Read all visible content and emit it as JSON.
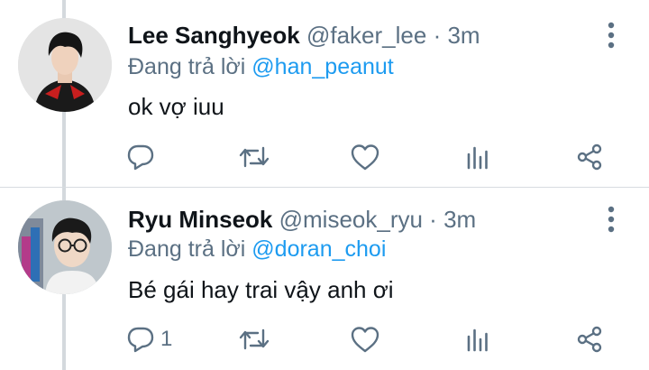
{
  "tweets": [
    {
      "display_name": "Lee Sanghyeok",
      "handle": "@faker_lee",
      "separator": "·",
      "time": "3m",
      "reply_prefix": "Đang trả lời",
      "reply_to": "@han_peanut",
      "text": "ok vợ iuu",
      "reply_count": ""
    },
    {
      "display_name": "Ryu Minseok",
      "handle": "@miseok_ryu",
      "separator": "·",
      "time": "3m",
      "reply_prefix": "Đang trả lời",
      "reply_to": "@doran_choi",
      "text": "Bé gái hay trai vậy anh ơi",
      "reply_count": "1"
    }
  ],
  "icons": {
    "reply": "speech-bubble-icon",
    "retweet": "retweet-icon",
    "like": "heart-icon",
    "stats": "bar-chart-icon",
    "share": "share-icon",
    "more": "vertical-ellipsis-icon"
  },
  "colors": {
    "text": "#0f1419",
    "muted": "#5b7083",
    "link": "#1d9bf0",
    "thread_line": "#d4d9dd",
    "divider": "#d7dce0"
  }
}
